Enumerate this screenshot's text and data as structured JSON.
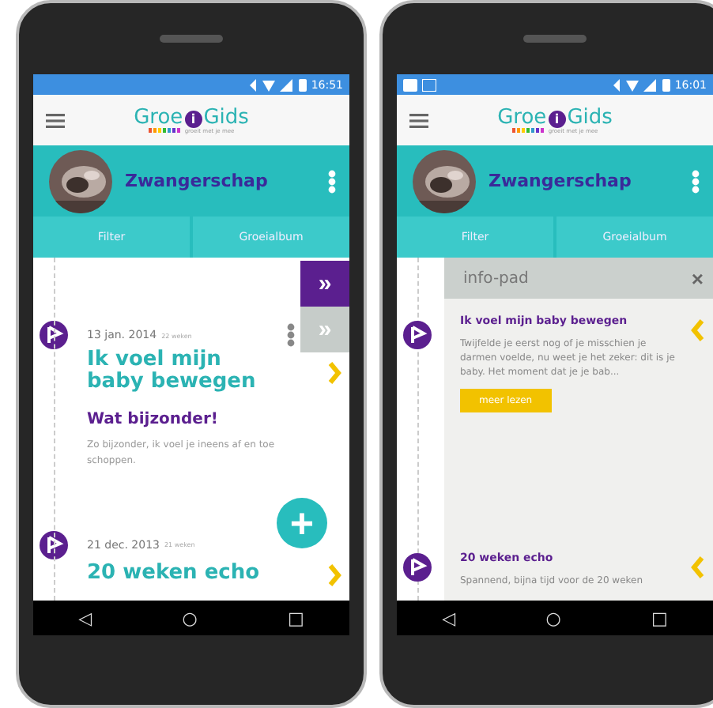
{
  "phones": [
    {
      "notification_icons": false,
      "status_time": "16:51",
      "logo": {
        "parts": [
          "Groe",
          "i",
          "Gids"
        ],
        "tagline": "groeit met je mee"
      },
      "profile": {
        "name": "Zwangerschap"
      },
      "tabs": [
        "Filter",
        "Groeialbum"
      ],
      "side_buttons": [
        {
          "label": "»",
          "kind": "primary"
        },
        {
          "label": "»",
          "kind": "secondary"
        }
      ],
      "timeline": [
        {
          "date": "13 jan. 2014",
          "weeks": "22 weken",
          "has_menu": true,
          "title": "Ik voel mijn baby bewegen",
          "subtitle": "Wat bijzonder!",
          "text": "Zo bijzonder, ik voel je ineens af en toe schoppen."
        },
        {
          "date": "21 dec. 2013",
          "weeks": "21 weken",
          "has_menu": false,
          "title": "20 weken echo"
        }
      ],
      "fab": "+",
      "nav_keys": [
        "◁",
        "○",
        "□"
      ]
    },
    {
      "notification_icons": true,
      "status_time": "16:01",
      "logo": {
        "parts": [
          "Groe",
          "i",
          "Gids"
        ],
        "tagline": "groeit met je mee"
      },
      "profile": {
        "name": "Zwangerschap"
      },
      "tabs": [
        "Filter",
        "Groeialbum"
      ],
      "info_pad": {
        "title": "info-pad",
        "close": "×",
        "items": [
          {
            "title": "Ik voel mijn baby bewegen",
            "text": "Twijfelde je eerst nog of je misschien je darmen voelde, nu weet je het zeker: dit is je baby. Het moment dat je je bab...",
            "button": "meer lezen"
          },
          {
            "title": "20 weken echo",
            "text": "Spannend, bijna tijd voor de 20 weken"
          }
        ]
      },
      "nav_keys": [
        "◁",
        "○",
        "□"
      ]
    }
  ]
}
